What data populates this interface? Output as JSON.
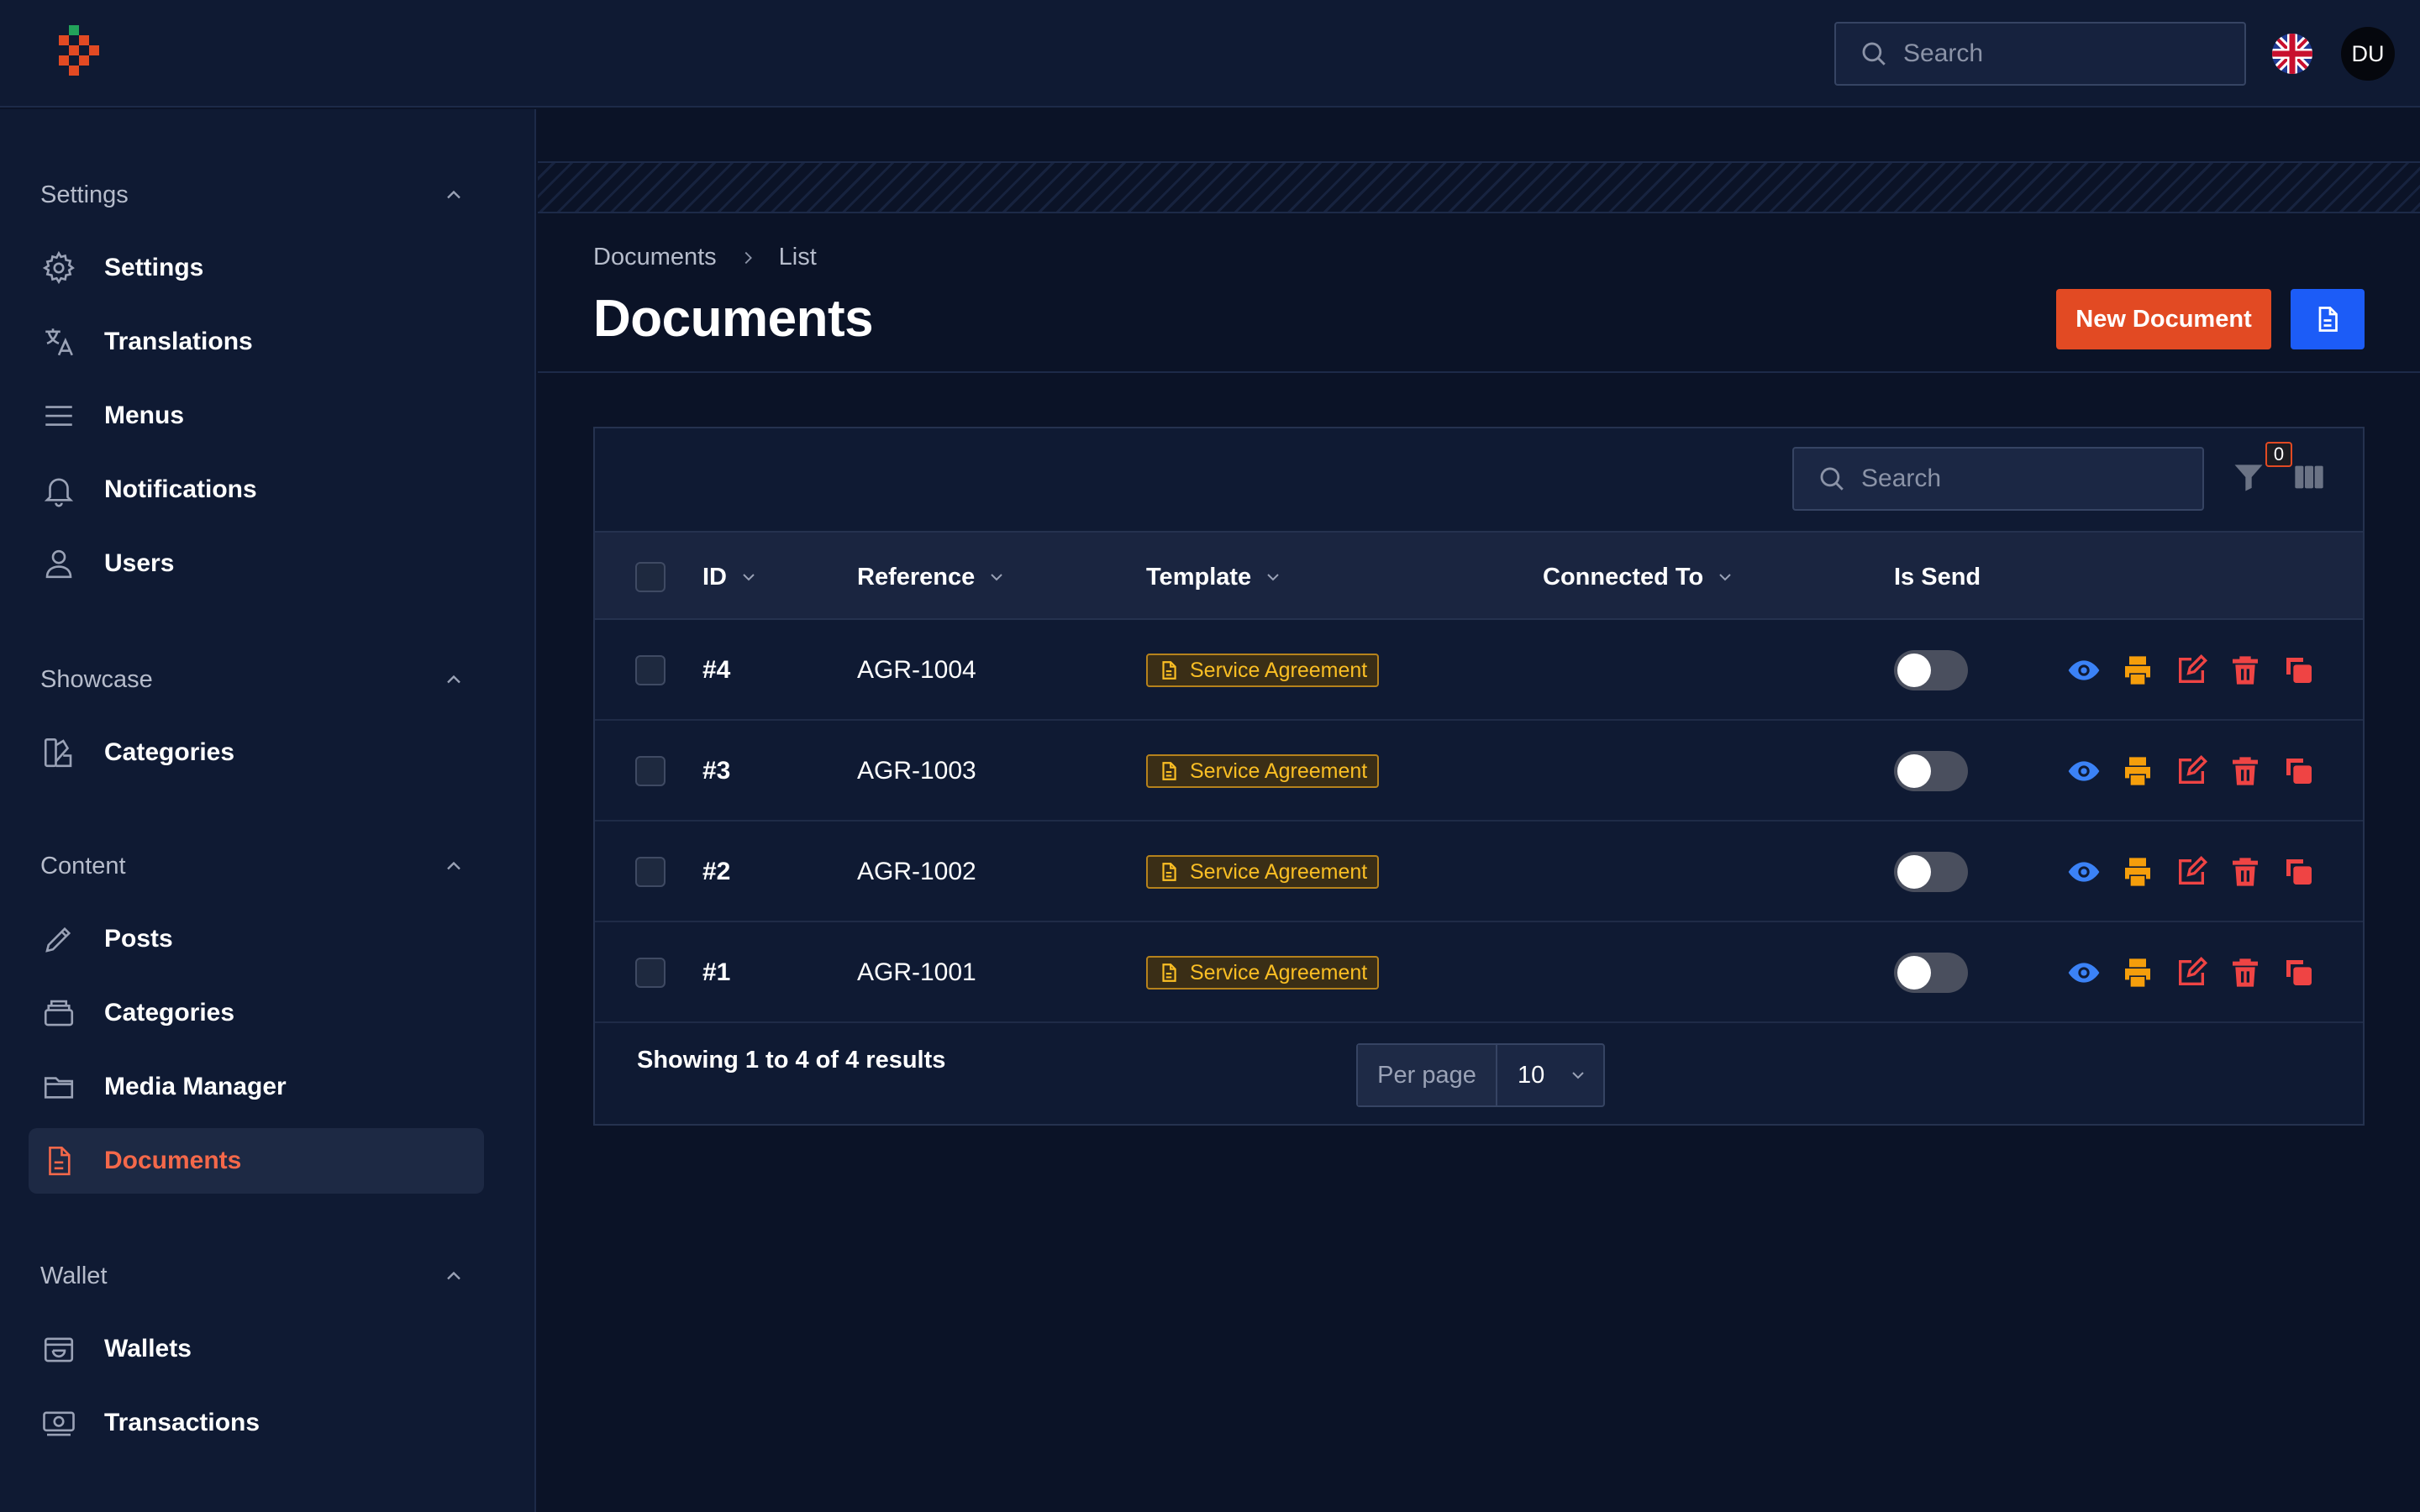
{
  "header": {
    "search_placeholder": "Search",
    "avatar_initials": "DU",
    "language_icon": "uk-flag-icon"
  },
  "sidebar": {
    "groups": [
      {
        "title": "Settings",
        "items": [
          {
            "label": "Settings",
            "icon": "gear-icon"
          },
          {
            "label": "Translations",
            "icon": "translate-icon"
          },
          {
            "label": "Menus",
            "icon": "menu-icon"
          },
          {
            "label": "Notifications",
            "icon": "bell-icon"
          },
          {
            "label": "Users",
            "icon": "user-icon"
          }
        ]
      },
      {
        "title": "Showcase",
        "items": [
          {
            "label": "Categories",
            "icon": "swatch-icon"
          }
        ]
      },
      {
        "title": "Content",
        "items": [
          {
            "label": "Posts",
            "icon": "pencil-icon"
          },
          {
            "label": "Categories",
            "icon": "stack-icon"
          },
          {
            "label": "Media Manager",
            "icon": "folder-icon"
          },
          {
            "label": "Documents",
            "icon": "document-icon",
            "active": true
          }
        ]
      },
      {
        "title": "Wallet",
        "items": [
          {
            "label": "Wallets",
            "icon": "wallet-icon"
          },
          {
            "label": "Transactions",
            "icon": "cash-icon"
          }
        ]
      }
    ]
  },
  "page": {
    "breadcrumb": [
      "Documents",
      "List"
    ],
    "title": "Documents",
    "new_button": "New Document"
  },
  "table": {
    "search_placeholder": "Search",
    "filter_count": "0",
    "columns": [
      "ID",
      "Reference",
      "Template",
      "Connected To",
      "Is Send"
    ],
    "rows": [
      {
        "id": "#4",
        "reference": "AGR-1004",
        "template": "Service Agreement",
        "connected_to": "",
        "is_send": false
      },
      {
        "id": "#3",
        "reference": "AGR-1003",
        "template": "Service Agreement",
        "connected_to": "",
        "is_send": false
      },
      {
        "id": "#2",
        "reference": "AGR-1002",
        "template": "Service Agreement",
        "connected_to": "",
        "is_send": false
      },
      {
        "id": "#1",
        "reference": "AGR-1001",
        "template": "Service Agreement",
        "connected_to": "",
        "is_send": false
      }
    ],
    "footer_text": "Showing 1 to 4 of 4 results",
    "per_page_label": "Per page",
    "per_page_value": "10"
  },
  "colors": {
    "accent": "#e24a23",
    "primary_blue": "#1c5cf7",
    "view": "#3b82f6",
    "print": "#f59e0b",
    "danger": "#ef4444",
    "badge": "#fbbf24"
  }
}
